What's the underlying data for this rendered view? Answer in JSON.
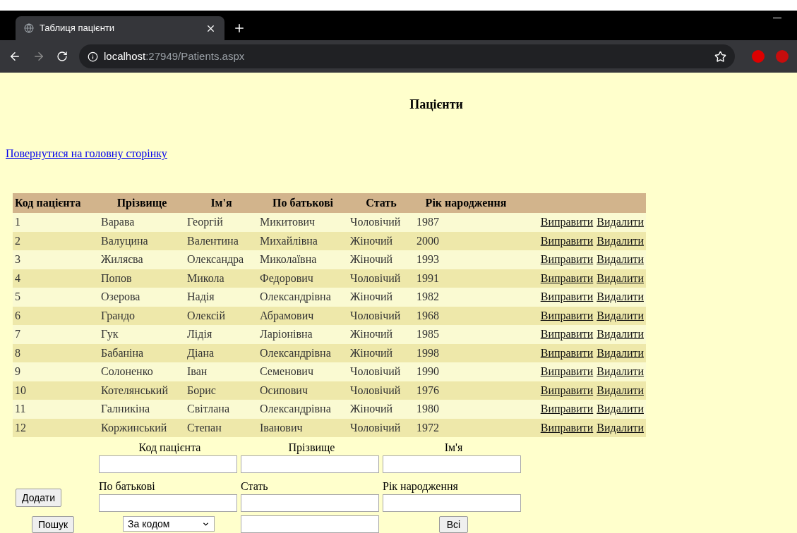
{
  "browser": {
    "tab_title": "Таблиця пацієнти",
    "url_host": "localhost",
    "url_rest": ":27949/Patients.aspx"
  },
  "page": {
    "title": "Пацієнти",
    "back_link": "Повернутися на головну сторінку"
  },
  "table": {
    "columns": [
      "Код пацієнта",
      "Прізвище",
      "Ім'я",
      "По батькові",
      "Стать",
      "Рік народження"
    ],
    "rows": [
      {
        "cells": [
          "1",
          "Варава",
          "Георгій",
          "Микитович",
          "Чоловічий",
          "1987"
        ],
        "actions": [
          "Виправити",
          "Видалити"
        ]
      },
      {
        "cells": [
          "2",
          "Валуцина",
          "Валентина",
          "Михайлівна",
          "Жіночий",
          "2000"
        ],
        "actions": [
          "Виправити",
          "Видалити"
        ]
      },
      {
        "cells": [
          "3",
          "Жиляєва",
          "Олександра",
          "Миколаївна",
          "Жіночий",
          "1993"
        ],
        "actions": [
          "Виправити",
          "Видалити"
        ]
      },
      {
        "cells": [
          "4",
          "Попов",
          "Микола",
          "Федорович",
          "Чоловічий",
          "1991"
        ],
        "actions": [
          "Виправити",
          "Видалити"
        ]
      },
      {
        "cells": [
          "5",
          "Озерова",
          "Надія",
          "Олександрівна",
          "Жіночий",
          "1982"
        ],
        "actions": [
          "Виправити",
          "Видалити"
        ]
      },
      {
        "cells": [
          "6",
          "Грандо",
          "Олексій",
          "Абрамович",
          "Чоловічий",
          "1968"
        ],
        "actions": [
          "Виправити",
          "Видалити"
        ]
      },
      {
        "cells": [
          "7",
          "Гук",
          "Лідія",
          "Ларіонівна",
          "Жіночий",
          "1985"
        ],
        "actions": [
          "Виправити",
          "Видалити"
        ]
      },
      {
        "cells": [
          "8",
          "Бабаніна",
          "Діана",
          "Олександрівна",
          "Жіночий",
          "1998"
        ],
        "actions": [
          "Виправити",
          "Видалити"
        ]
      },
      {
        "cells": [
          "9",
          "Солоненко",
          "Іван",
          "Семенович",
          "Чоловічий",
          "1990"
        ],
        "actions": [
          "Виправити",
          "Видалити"
        ]
      },
      {
        "cells": [
          "10",
          "Котелянський",
          "Борис",
          "Осипович",
          "Чоловічий",
          "1976"
        ],
        "actions": [
          "Виправити",
          "Видалити"
        ]
      },
      {
        "cells": [
          "11",
          "Галникіна",
          "Світлана",
          "Олександрівна",
          "Жіночий",
          "1980"
        ],
        "actions": [
          "Виправити",
          "Видалити"
        ]
      },
      {
        "cells": [
          "12",
          "Коржинський",
          "Степан",
          "Іванович",
          "Чоловічий",
          "1972"
        ],
        "actions": [
          "Виправити",
          "Видалити"
        ]
      }
    ]
  },
  "form": {
    "top_labels": [
      "Код пацієнта",
      "Прізвище",
      "Ім'я"
    ],
    "add_button": "Додати",
    "bottom_labels": [
      "По батькові",
      "Стать",
      "Рік народження"
    ],
    "search_button": "Пошук",
    "search_by": "За кодом",
    "all_button": "Всі"
  }
}
